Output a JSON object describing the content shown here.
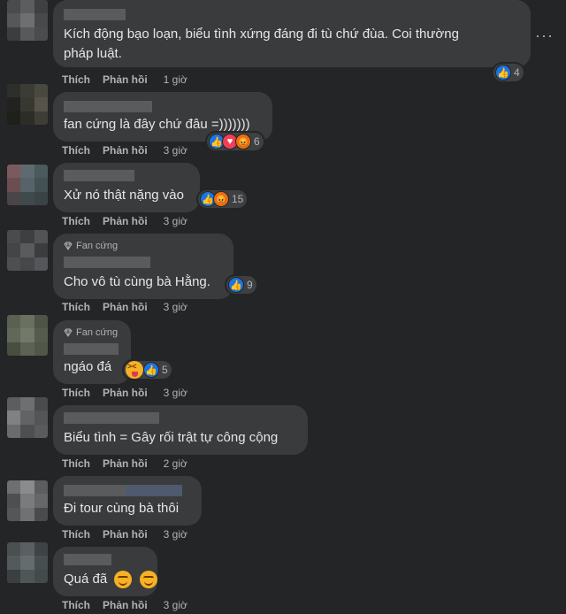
{
  "labels": {
    "like": "Thích",
    "reply": "Phản hồi",
    "more": "···"
  },
  "badge_label": "Fan cứng",
  "comments": [
    {
      "text": "Kích động bạo loạn, biểu tình xứng đáng đi tù chứ đùa. Coi thường",
      "text2": "pháp luật.",
      "reaction_count": "4",
      "time": "1 giờ"
    },
    {
      "text": "fan cứng là đây chứ đâu =)))))))",
      "reaction_count": "6",
      "time": "3 giờ"
    },
    {
      "text": "Xử nó thật nặng vào",
      "reaction_count": "15",
      "time": "3 giờ"
    },
    {
      "text": "Cho vô tù cùng bà Hằng.",
      "reaction_count": "9",
      "time": "3 giờ"
    },
    {
      "text": "ngáo đá",
      "reaction_count": "5",
      "time": "3 giờ"
    },
    {
      "text": "Biểu tình = Gây rối trật tự công cộng",
      "reaction_count": "",
      "time": "2 giờ"
    },
    {
      "text": "Đi tour cùng bà thôi",
      "reaction_count": "",
      "time": "3 giờ"
    },
    {
      "text": "Quá đã",
      "reaction_count": "",
      "time": "3 giờ"
    }
  ],
  "icons": {
    "like": "like-reaction-icon",
    "love": "love-reaction-icon",
    "angry": "angry-reaction-icon",
    "haha": "haha-reaction-icon",
    "badge": "diamond-icon"
  },
  "colors": {
    "background": "#242526",
    "bubble": "#3a3b3c",
    "like": "#1b74e4",
    "love": "#f33e58",
    "angry": "#e9710f"
  }
}
